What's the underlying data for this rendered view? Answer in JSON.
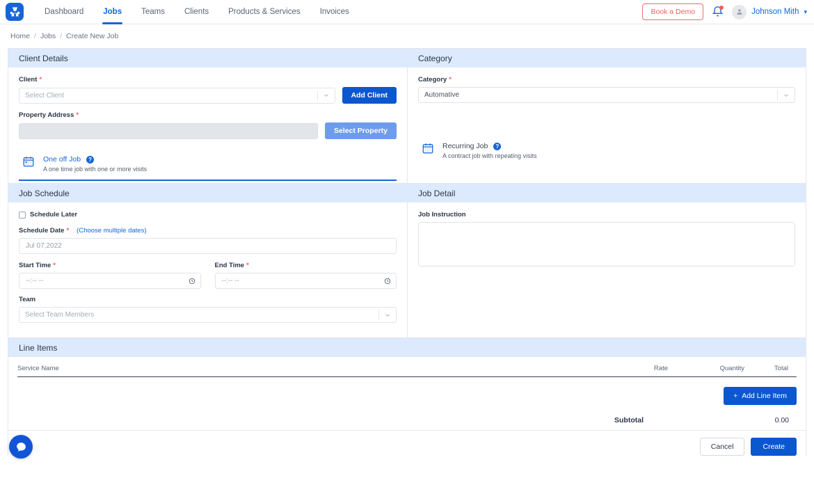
{
  "app": {
    "logo_icon": "worker-mascot-logo",
    "accent_blue": "#1565d8",
    "primary_button_blue": "#0b57d0",
    "panel_header_blue": "#ddeafd",
    "danger_red": "#ef5f5f"
  },
  "nav": {
    "items": [
      {
        "label": "Dashboard",
        "active": false
      },
      {
        "label": "Jobs",
        "active": true
      },
      {
        "label": "Teams",
        "active": false
      },
      {
        "label": "Clients",
        "active": false
      },
      {
        "label": "Products & Services",
        "active": false
      },
      {
        "label": "Invoices",
        "active": false
      }
    ],
    "demo_button": "Book a Demo",
    "bell_icon": "notification-bell-icon",
    "user_name": "Johnson Mith",
    "avatar_icon": "user-avatar-icon",
    "caret_icon": "chevron-down-icon"
  },
  "breadcrumb": {
    "home": "Home",
    "sep": "/",
    "jobs": "Jobs",
    "current": "Create New Job"
  },
  "client_details": {
    "title": "Client Details",
    "client_label": "Client",
    "client_required": "*",
    "client_placeholder": "Select Client",
    "add_client_button": "Add Client",
    "property_label": "Property Address",
    "property_required": "*",
    "select_property_button": "Select Property"
  },
  "category": {
    "title": "Category",
    "label": "Category",
    "required": "*",
    "value": "Automative"
  },
  "job_types": {
    "one_off": {
      "title": "One off Job",
      "subtitle": "A one time job with one or more visits",
      "icon": "calendar-icon",
      "help_icon": "question-mark-icon",
      "selected": true
    },
    "recurring": {
      "title": "Recurring Job",
      "subtitle": "A contract job with repeating visits",
      "icon": "calendar-recurring-icon",
      "help_icon": "question-mark-icon",
      "selected": false
    }
  },
  "job_schedule": {
    "title": "Job Schedule",
    "schedule_later_label": "Schedule Later",
    "schedule_later_checked": false,
    "schedule_date_label": "Schedule Date",
    "schedule_date_required": "*",
    "choose_multiple_link": "(Choose multiple dates)",
    "schedule_date_value": "Jul 07,2022",
    "start_time_label": "Start Time",
    "start_time_required": "*",
    "start_time_placeholder": "--:-- --",
    "end_time_label": "End Time",
    "end_time_required": "*",
    "end_time_placeholder": "--:-- --",
    "clock_icon": "clock-icon",
    "team_label": "Team",
    "team_placeholder": "Select Team Members"
  },
  "job_detail": {
    "title": "Job Detail",
    "instruction_label": "Job Instruction",
    "instruction_value": ""
  },
  "line_items": {
    "title": "Line Items",
    "columns": [
      "Service Name",
      "Rate",
      "Quantity",
      "Total"
    ],
    "rows": [],
    "add_button": "Add Line Item",
    "add_icon": "plus-icon",
    "subtotal_label": "Subtotal",
    "subtotal_value": "0.00"
  },
  "footer": {
    "cancel_button": "Cancel",
    "create_button": "Create"
  },
  "chat": {
    "icon": "chat-bubble-icon"
  }
}
